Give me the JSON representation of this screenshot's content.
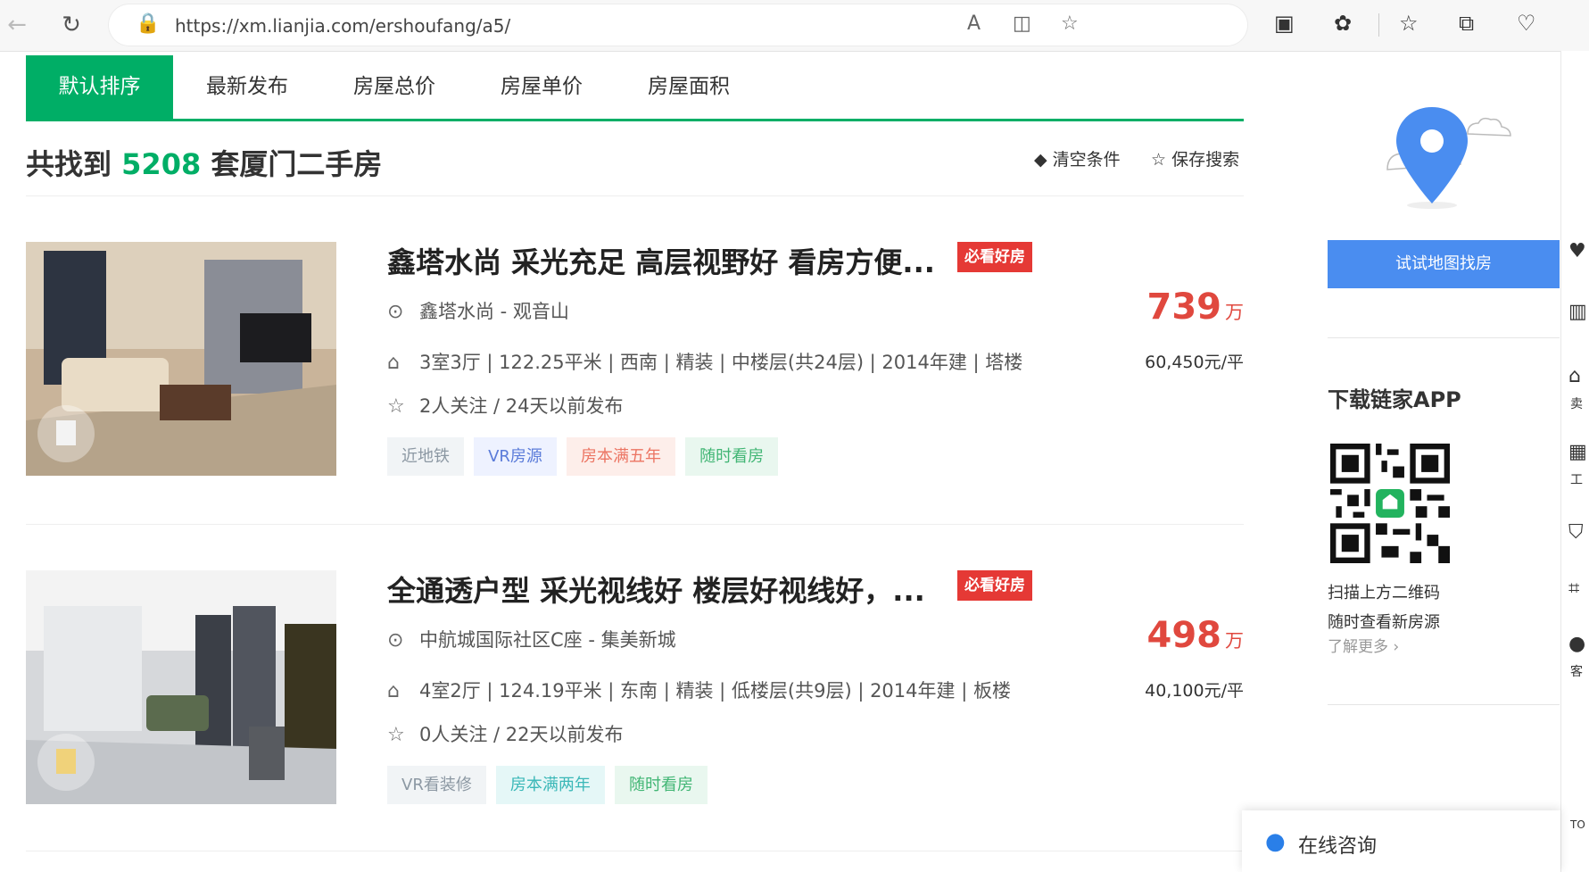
{
  "browser": {
    "url": "https://xm.lianjia.com/ershoufang/a5/",
    "icons": [
      "back-icon",
      "refresh-icon",
      "lock-icon",
      "read-aloud-icon",
      "split-screen-icon",
      "favorite-star-icon",
      "tab-icon",
      "extensions-icon",
      "favorites-icon",
      "collections-icon",
      "performance-icon"
    ]
  },
  "sort": {
    "tabs": [
      "默认排序",
      "最新发布",
      "房屋总价",
      "房屋单价",
      "房屋面积"
    ],
    "active_index": 0
  },
  "summary": {
    "prefix": "共找到",
    "count": "5208",
    "suffix": "套厦门二手房",
    "clear_label": "清空条件",
    "save_label": "保存搜索"
  },
  "listings": [
    {
      "title": "鑫塔水尚 采光充足 高层视野好 看房方便...",
      "badge": "必看好房",
      "location": "鑫塔水尚 - 观音山",
      "info": "3室3厅 | 122.25平米 | 西南 | 精装 | 中楼层(共24层) | 2014年建 | 塔楼",
      "follow": "2人关注 / 24天以前发布",
      "price": "739",
      "price_unit": "万",
      "unit_price": "60,450元/平",
      "tags": [
        "近地铁",
        "VR房源",
        "房本满五年",
        "随时看房"
      ]
    },
    {
      "title": "全通透户型 采光视线好 楼层好视线好，...",
      "badge": "必看好房",
      "location": "中航城国际社区C座 - 集美新城",
      "info": "4室2厅 | 124.19平米 | 东南 | 精装 | 低楼层(共9层) | 2014年建 | 板楼",
      "follow": "0人关注 / 22天以前发布",
      "price": "498",
      "price_unit": "万",
      "unit_price": "40,100元/平",
      "tags": [
        "VR看装修",
        "房本满两年",
        "随时看房"
      ]
    }
  ],
  "sidebar": {
    "map_button": "试试地图找房",
    "app_title": "下载链家APP",
    "scan_text": "扫描上方二维码",
    "scan_text2": "随时查看新房源",
    "more": "了解更多 ›"
  },
  "right_strip": {
    "labels": [
      "卖",
      "工",
      "客",
      "TO"
    ]
  },
  "consult": {
    "label": "在线咨询"
  },
  "colors": {
    "brand_green": "#00ae66",
    "price_red": "#e0483e",
    "badge_red": "#e53935",
    "map_blue": "#4a8df0"
  }
}
